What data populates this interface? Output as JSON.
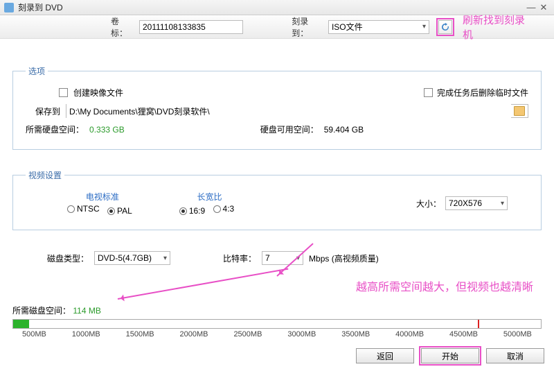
{
  "window": {
    "title": "刻录到 DVD"
  },
  "header": {
    "volume_label": "卷标：",
    "volume_value": "20111108133835",
    "burn_to_label": "刻录到：",
    "burn_to_value": "ISO文件",
    "refresh_annotation": "刷新找到刻录机"
  },
  "options": {
    "legend": "选项",
    "create_image_label": "创建映像文件",
    "delete_temp_label": "完成任务后删除临时文件",
    "save_to_label": "保存到",
    "save_to_value": "D:\\My Documents\\狸窝\\DVD刻录软件\\",
    "req_hdd_label": "所需硬盘空间：",
    "req_hdd_value": "0.333 GB",
    "avail_hdd_label": "硬盘可用空间：",
    "avail_hdd_value": "59.404 GB"
  },
  "video": {
    "legend": "视频设置",
    "tv_std_label": "电视标准",
    "ntsc": "NTSC",
    "pal": "PAL",
    "aspect_label": "长宽比",
    "a169": "16:9",
    "a43": "4:3",
    "size_label": "大小：",
    "size_value": "720X576"
  },
  "disc": {
    "type_label": "磁盘类型：",
    "type_value": "DVD-5(4.7GB)",
    "bitrate_label": "比特率：",
    "bitrate_value": "7",
    "bitrate_unit": "Mbps (高视频质量)"
  },
  "annotation_main": "越高所需空间越大，但视频也越清晰",
  "usage": {
    "label": "所需磁盘空间：",
    "value": "114 MB",
    "ticks": [
      "500MB",
      "1000MB",
      "1500MB",
      "2000MB",
      "2500MB",
      "3000MB",
      "3500MB",
      "4000MB",
      "4500MB",
      "5000MB"
    ]
  },
  "footer": {
    "back": "返回",
    "start": "开始",
    "cancel": "取消"
  }
}
